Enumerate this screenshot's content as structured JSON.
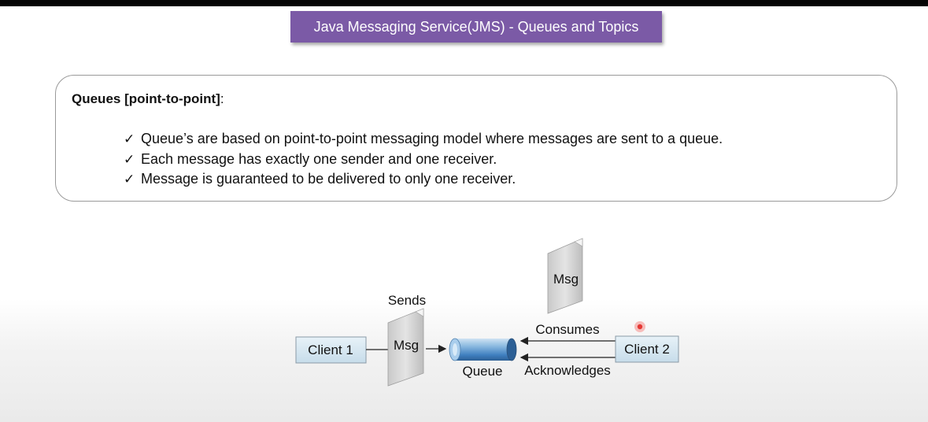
{
  "header": {
    "title": "Java Messaging Service(JMS) - Queues and Topics"
  },
  "queues_card": {
    "heading": "Queues [point-to-point]",
    "heading_suffix": ":",
    "check_glyph": "✓",
    "bullets": [
      "Queue’s are based on point-to-point messaging model where messages are sent to a queue.",
      "Each message has exactly one sender and one receiver.",
      "Message is guaranteed to be delivered to only one receiver."
    ]
  },
  "diagram": {
    "client1": "Client 1",
    "client2": "Client 2",
    "sends": "Sends",
    "msg_sent": "Msg",
    "msg_consumed": "Msg",
    "queue": "Queue",
    "consumes": "Consumes",
    "acknowledges": "Acknowledges"
  },
  "colors": {
    "title_bg": "#7b5aa6",
    "client_box_bg": "#d8e9f3",
    "queue_blue": "#5b9bd5",
    "cursor_red": "#e53935"
  }
}
